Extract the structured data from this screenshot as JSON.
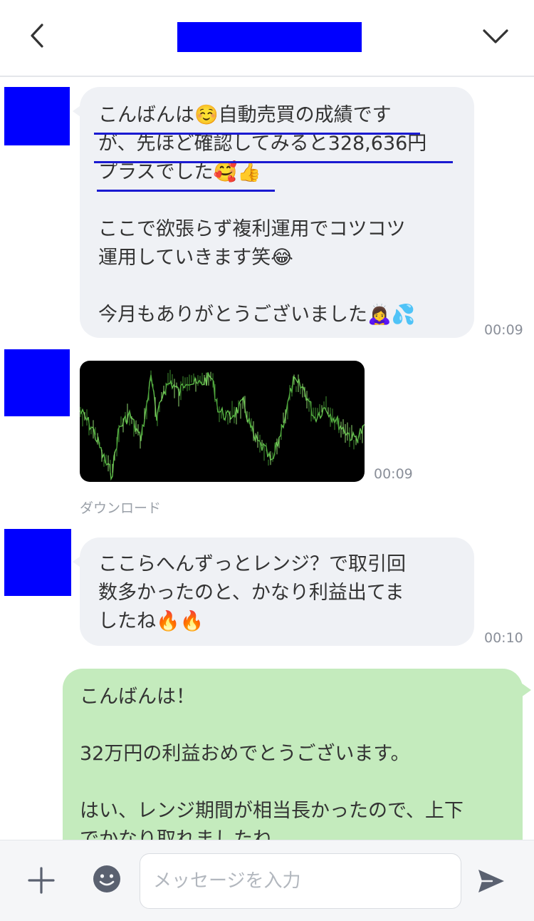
{
  "header": {
    "title_redaction_color": "#0000ff",
    "back_icon": "chevron-left-icon",
    "menu_icon": "chevron-down-icon"
  },
  "messages": [
    {
      "sender": "other",
      "avatar_color": "#0000ff",
      "lines": [
        "こんばんは☺️自動売買の成績です",
        "が、先ほど確認してみると328,636円",
        "プラスでした🥰👍",
        "",
        "ここで欲張らず複利運用でコツコツ",
        "運用していきます笑😂",
        "",
        "今月もありがとうございました🙇‍♀️💦"
      ],
      "highlight_color": "#1a1ad1",
      "time": "00:09"
    },
    {
      "sender": "other",
      "avatar_color": "#0000ff",
      "image": "price-chart-image",
      "time": "00:09",
      "download_label": "ダウンロード"
    },
    {
      "sender": "other",
      "avatar_color": "#0000ff",
      "lines": [
        "ここらへんずっとレンジ？で取引回",
        "数多かったのと、かなり利益出てま",
        "したね🔥🔥"
      ],
      "time": "00:10"
    },
    {
      "sender": "me",
      "lines": [
        "こんばんは！",
        "",
        "32万円の利益おめでとうございます。",
        "",
        "はい、レンジ期間が相当長かったので、上下",
        "でかなり取れましたね。"
      ]
    }
  ],
  "composer": {
    "placeholder": "メッセージを入力",
    "value": "",
    "plus_icon": "plus-icon",
    "sticker_icon": "smiley-icon",
    "send_icon": "send-icon"
  },
  "colors": {
    "incoming_bubble": "#eff1f5",
    "outgoing_bubble": "#c4ebbd",
    "redaction": "#0000ff"
  }
}
